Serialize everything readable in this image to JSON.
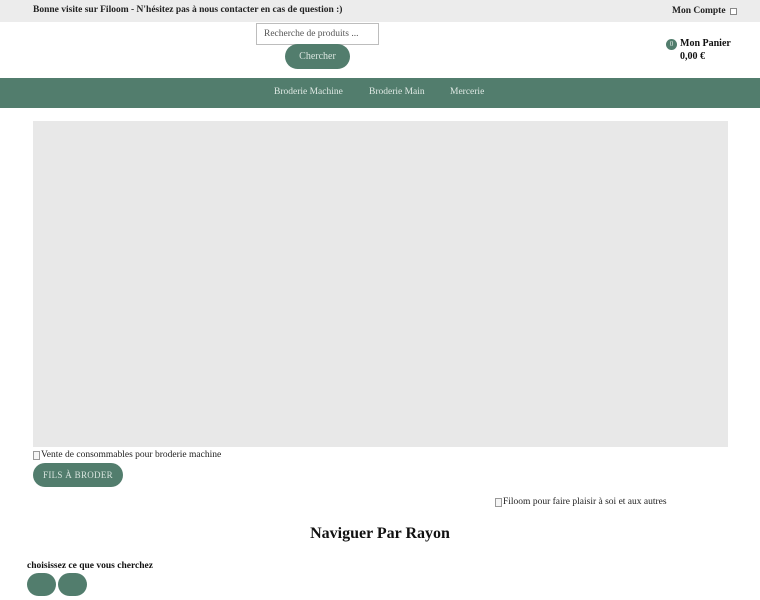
{
  "topbar": {
    "welcome": "Bonne visite sur Filoom - N'hésitez pas à nous contacter en cas de question :)",
    "account_label": "Mon Compte"
  },
  "search": {
    "placeholder": "Recherche de produits ...",
    "value": "",
    "button_label": "Chercher"
  },
  "cart": {
    "count": "0",
    "label": "Mon Panier",
    "total": "0,00 €"
  },
  "nav": {
    "items": [
      {
        "label": "Broderie Machine"
      },
      {
        "label": "Broderie Main"
      },
      {
        "label": "Mercerie"
      }
    ]
  },
  "banner": {
    "image_alt": "Vente de consommables pour broderie machine",
    "button_label": "FILS À BRODER",
    "secondary_image_alt": "Filoom pour faire plaisir à soi et aux autres"
  },
  "rayon": {
    "title": "Naviguer Par Rayon",
    "subtitle": "choisissez ce que vous cherchez"
  },
  "colors": {
    "brand_green": "#527d6d",
    "topbar_bg": "#ececec",
    "hero_placeholder": "#e8e8e8"
  }
}
